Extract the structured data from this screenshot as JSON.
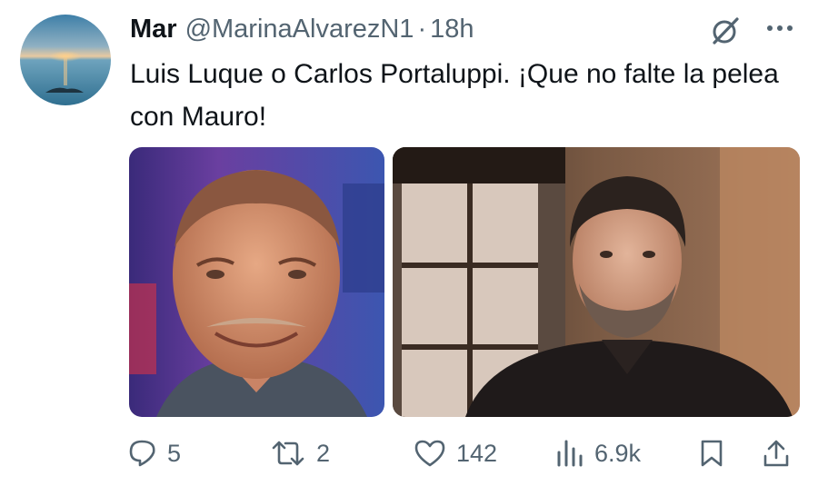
{
  "tweet": {
    "display_name": "Mar",
    "handle": "@MarinaAlvarezN1",
    "separator": "·",
    "time": "18h",
    "text": "Luis Luque o Carlos Portaluppi. ¡Que no falte la pelea con Mauro!",
    "icons": {
      "avatar": "avatar-sunset-sea",
      "grok": "grok-icon",
      "more": "more-icon"
    },
    "photos": [
      {
        "name": "photo-luis-luque"
      },
      {
        "name": "photo-carlos-portaluppi"
      }
    ],
    "actions": {
      "replies": "5",
      "reposts": "2",
      "likes": "142",
      "views": "6.9k"
    }
  },
  "colors": {
    "text": "#0f1419",
    "secondary": "#536471"
  }
}
